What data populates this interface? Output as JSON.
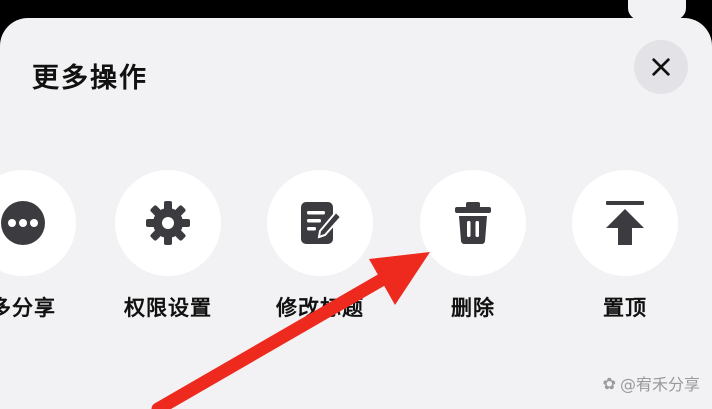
{
  "sheet": {
    "title": "更多操作",
    "close_label": "×"
  },
  "actions": [
    {
      "label": "多分享",
      "icon": "more-dots-icon"
    },
    {
      "label": "权限设置",
      "icon": "gear-icon"
    },
    {
      "label": "修改标题",
      "icon": "edit-document-icon"
    },
    {
      "label": "删除",
      "icon": "trash-icon"
    },
    {
      "label": "置顶",
      "icon": "pin-top-icon"
    }
  ],
  "watermark": {
    "text": "@宥禾分享"
  },
  "colors": {
    "sheet_bg": "#f2f2f4",
    "icon": "#3c3c40",
    "annotation_arrow": "#ee2a1e"
  }
}
